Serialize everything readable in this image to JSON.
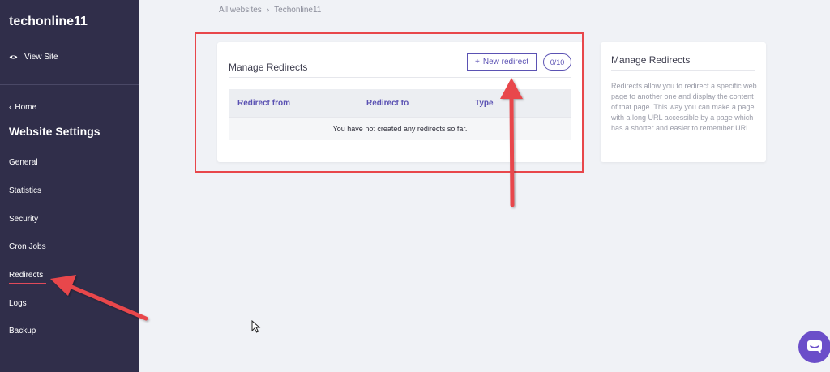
{
  "sidebar": {
    "site_name": "techonline11",
    "view_site_label": "View Site",
    "home_label": "Home",
    "settings_title": "Website Settings",
    "items": [
      {
        "label": "General"
      },
      {
        "label": "Statistics"
      },
      {
        "label": "Security"
      },
      {
        "label": "Cron Jobs"
      },
      {
        "label": "Redirects",
        "active": true
      },
      {
        "label": "Logs"
      },
      {
        "label": "Backup"
      }
    ]
  },
  "breadcrumb": {
    "root": "All websites",
    "separator": "›",
    "current": "Techonline11"
  },
  "main_card": {
    "title": "Manage Redirects",
    "new_redirect_label": "New redirect",
    "new_redirect_icon": "plus-icon",
    "count": "0/10",
    "table": {
      "columns": [
        "Redirect from",
        "Redirect to",
        "Type"
      ],
      "empty_message": "You have not created any redirects so far."
    }
  },
  "info_card": {
    "title": "Manage Redirects",
    "text": "Redirects allow you to redirect a specific web page to another one and display the content of that page. This way you can make a page with a long URL accessible by a page which has a shorter and easier to remember URL."
  },
  "colors": {
    "sidebar_bg": "#302e4a",
    "accent": "#5b52b3",
    "annotation_red": "#e8474b",
    "chat_purple": "#6b4ec9",
    "page_bg": "#f0f2f6"
  }
}
